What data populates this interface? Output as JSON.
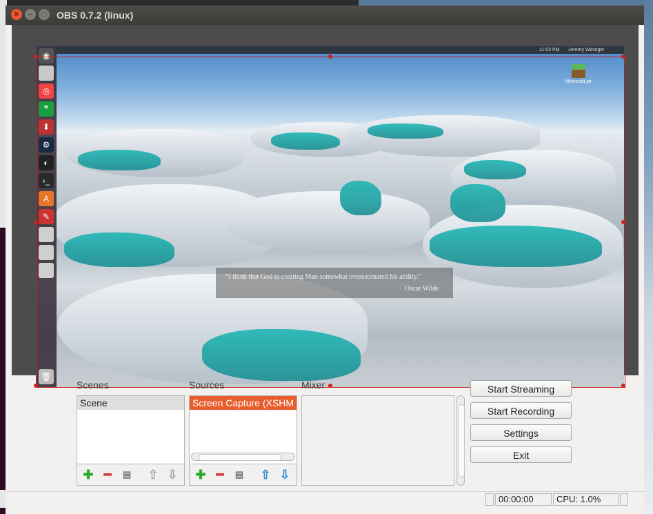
{
  "window": {
    "title": "OBS 0.7.2 (linux)"
  },
  "desktop_preview": {
    "panel_time": "11:03 PM",
    "panel_user": "Jeremy Wininger",
    "desktop_icon_label": "Minecraft.jar",
    "quote_text": "“I think that God in creating Man somewhat overestimated his ability.”",
    "quote_author": "Oscar Wilde"
  },
  "scenes": {
    "label": "Scenes",
    "items": [
      "Scene"
    ]
  },
  "sources": {
    "label": "Sources",
    "items": [
      "Screen Capture (XSHM"
    ]
  },
  "mixer": {
    "label": "Mixer"
  },
  "controls": {
    "start_streaming": "Start Streaming",
    "start_recording": "Start Recording",
    "settings": "Settings",
    "exit": "Exit"
  },
  "status": {
    "time": "00:00:00",
    "cpu": "CPU: 1.0%"
  },
  "icons": {
    "add": "plus-icon",
    "remove": "minus-icon",
    "properties": "properties-icon",
    "up": "arrow-up-icon",
    "down": "arrow-down-icon"
  },
  "colors": {
    "selection": "#d02020",
    "source_selected": "#e85d2d",
    "close_button": "#e9562b"
  }
}
